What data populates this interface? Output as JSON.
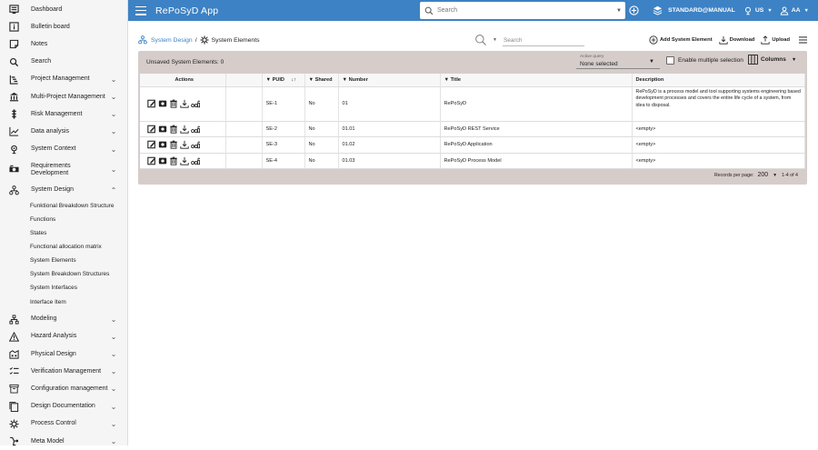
{
  "app": {
    "title": "RePoSyD App"
  },
  "topbar": {
    "search_placeholder": "Search",
    "mode": "STANDARD@MANUAL",
    "language": "US",
    "user": "AA"
  },
  "sidebar": {
    "items_top": [
      {
        "label": "Dashboard",
        "icon": "dashboard-icon"
      },
      {
        "label": "Bulletin board",
        "icon": "info-icon"
      },
      {
        "label": "Notes",
        "icon": "note-icon"
      },
      {
        "label": "Search",
        "icon": "search-icon"
      },
      {
        "label": "Project Management",
        "icon": "project-icon"
      },
      {
        "label": "Multi-Project Management",
        "icon": "institution-icon"
      },
      {
        "label": "Risk Management",
        "icon": "risk-icon"
      },
      {
        "label": "Data analysis",
        "icon": "chart-line-icon"
      },
      {
        "label": "System Context",
        "icon": "context-icon"
      },
      {
        "label": "Requirements Development",
        "icon": "requirements-icon"
      },
      {
        "label": "System Design",
        "icon": "sitemap-icon"
      }
    ],
    "sub_items": [
      "Funktional Breakdown Structure",
      "Functions",
      "States",
      "Functional allocation matrix",
      "System Elements",
      "System Breakdown Structures",
      "System Interfaces",
      "Interface Item"
    ],
    "items_bottom": [
      {
        "label": "Modeling",
        "icon": "modeling-icon"
      },
      {
        "label": "Hazard Analysis",
        "icon": "warning-icon"
      },
      {
        "label": "Physical Design",
        "icon": "factory-icon"
      },
      {
        "label": "Verification Management",
        "icon": "checklist-icon"
      },
      {
        "label": "Configuration management",
        "icon": "archive-icon"
      },
      {
        "label": "Design Documentation",
        "icon": "documents-icon"
      },
      {
        "label": "Process Control",
        "icon": "process-icon"
      },
      {
        "label": "Meta Model",
        "icon": "meta-model-icon"
      }
    ]
  },
  "breadcrumb": {
    "parent": "System Design",
    "separator": "/",
    "current": "System Elements"
  },
  "page_search": {
    "placeholder": "Search"
  },
  "page_actions": {
    "add": "Add System Element",
    "download": "Download",
    "upload": "Upload"
  },
  "panel": {
    "unsaved": "Unsaved System Elements: 0",
    "active_query_label": "Active query",
    "active_query_value": "None selected",
    "multi_select": "Enable multiple selection",
    "columns": "Columns"
  },
  "table": {
    "headers": {
      "actions": "Actions",
      "puid": "PUID",
      "shared": "Shared",
      "number": "Number",
      "title": "Title",
      "description": "Description"
    },
    "rows": [
      {
        "puid": "SE-1",
        "shared": "No",
        "number": "01",
        "title": "RePoSyD",
        "description": "RePoSyD is a process model and tool supporting systems engineering based development processes and covers the entire life cycle of a system, from idea to disposal."
      },
      {
        "puid": "SE-2",
        "shared": "No",
        "number": "01.01",
        "title": "RePoSyD REST Service",
        "description": "<empty>"
      },
      {
        "puid": "SE-3",
        "shared": "No",
        "number": "01.02",
        "title": "RePoSyD Application",
        "description": "<empty>"
      },
      {
        "puid": "SE-4",
        "shared": "No",
        "number": "01.03",
        "title": "RePoSyD Process Model",
        "description": "<empty>"
      }
    ]
  },
  "footer": {
    "records_label": "Records per page:",
    "records_value": "200",
    "range": "1-4 of 4"
  },
  "colors": {
    "topbar": "#3d82c4",
    "panel": "#d6cdcb",
    "link": "#3d82c4"
  }
}
